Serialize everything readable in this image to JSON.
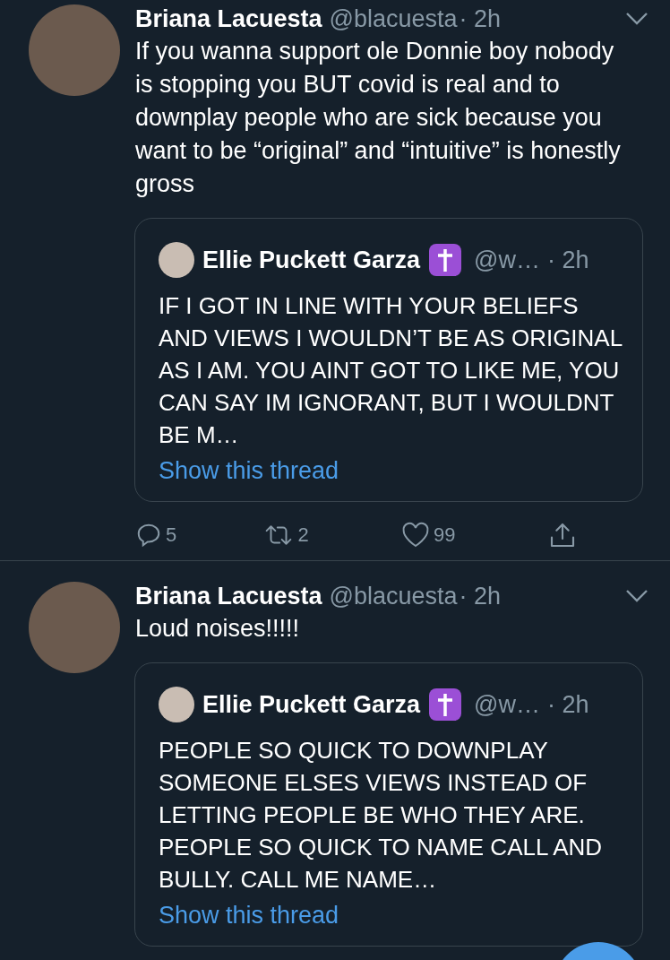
{
  "tweets": [
    {
      "author": "Briana Lacuesta",
      "handle": "@blacuesta",
      "time": "· 2h",
      "text": "If you wanna support ole Donnie boy nobody is stopping you BUT covid is real and to downplay people who are sick because you want to be “original” and “intuitive” is honestly gross",
      "quote": {
        "author": "Ellie Puckett Garza",
        "handle": "@w…",
        "time": "· 2h",
        "text": "IF I GOT IN LINE WITH YOUR BELIEFS AND VIEWS I WOULDN’T BE AS ORIGINAL AS I AM. YOU AINT GOT TO LIKE ME, YOU CAN SAY IM IGNORANT, BUT I WOULDNT BE M…",
        "link": "Show this thread"
      },
      "actions": {
        "replies": "5",
        "retweets": "2",
        "likes": "99"
      }
    },
    {
      "author": "Briana Lacuesta",
      "handle": "@blacuesta",
      "time": "· 2h",
      "text": "Loud noises!!!!!",
      "quote": {
        "author": "Ellie Puckett Garza",
        "handle": "@w…",
        "time": "· 2h",
        "text": "PEOPLE SO QUICK TO DOWNPLAY SOMEONE ELSES VIEWS INSTEAD OF LETTING PEOPLE BE WHO THEY ARE. PEOPLE SO QUICK TO NAME CALL AND BULLY. CALL ME NAME…",
        "link": "Show this thread"
      }
    }
  ]
}
